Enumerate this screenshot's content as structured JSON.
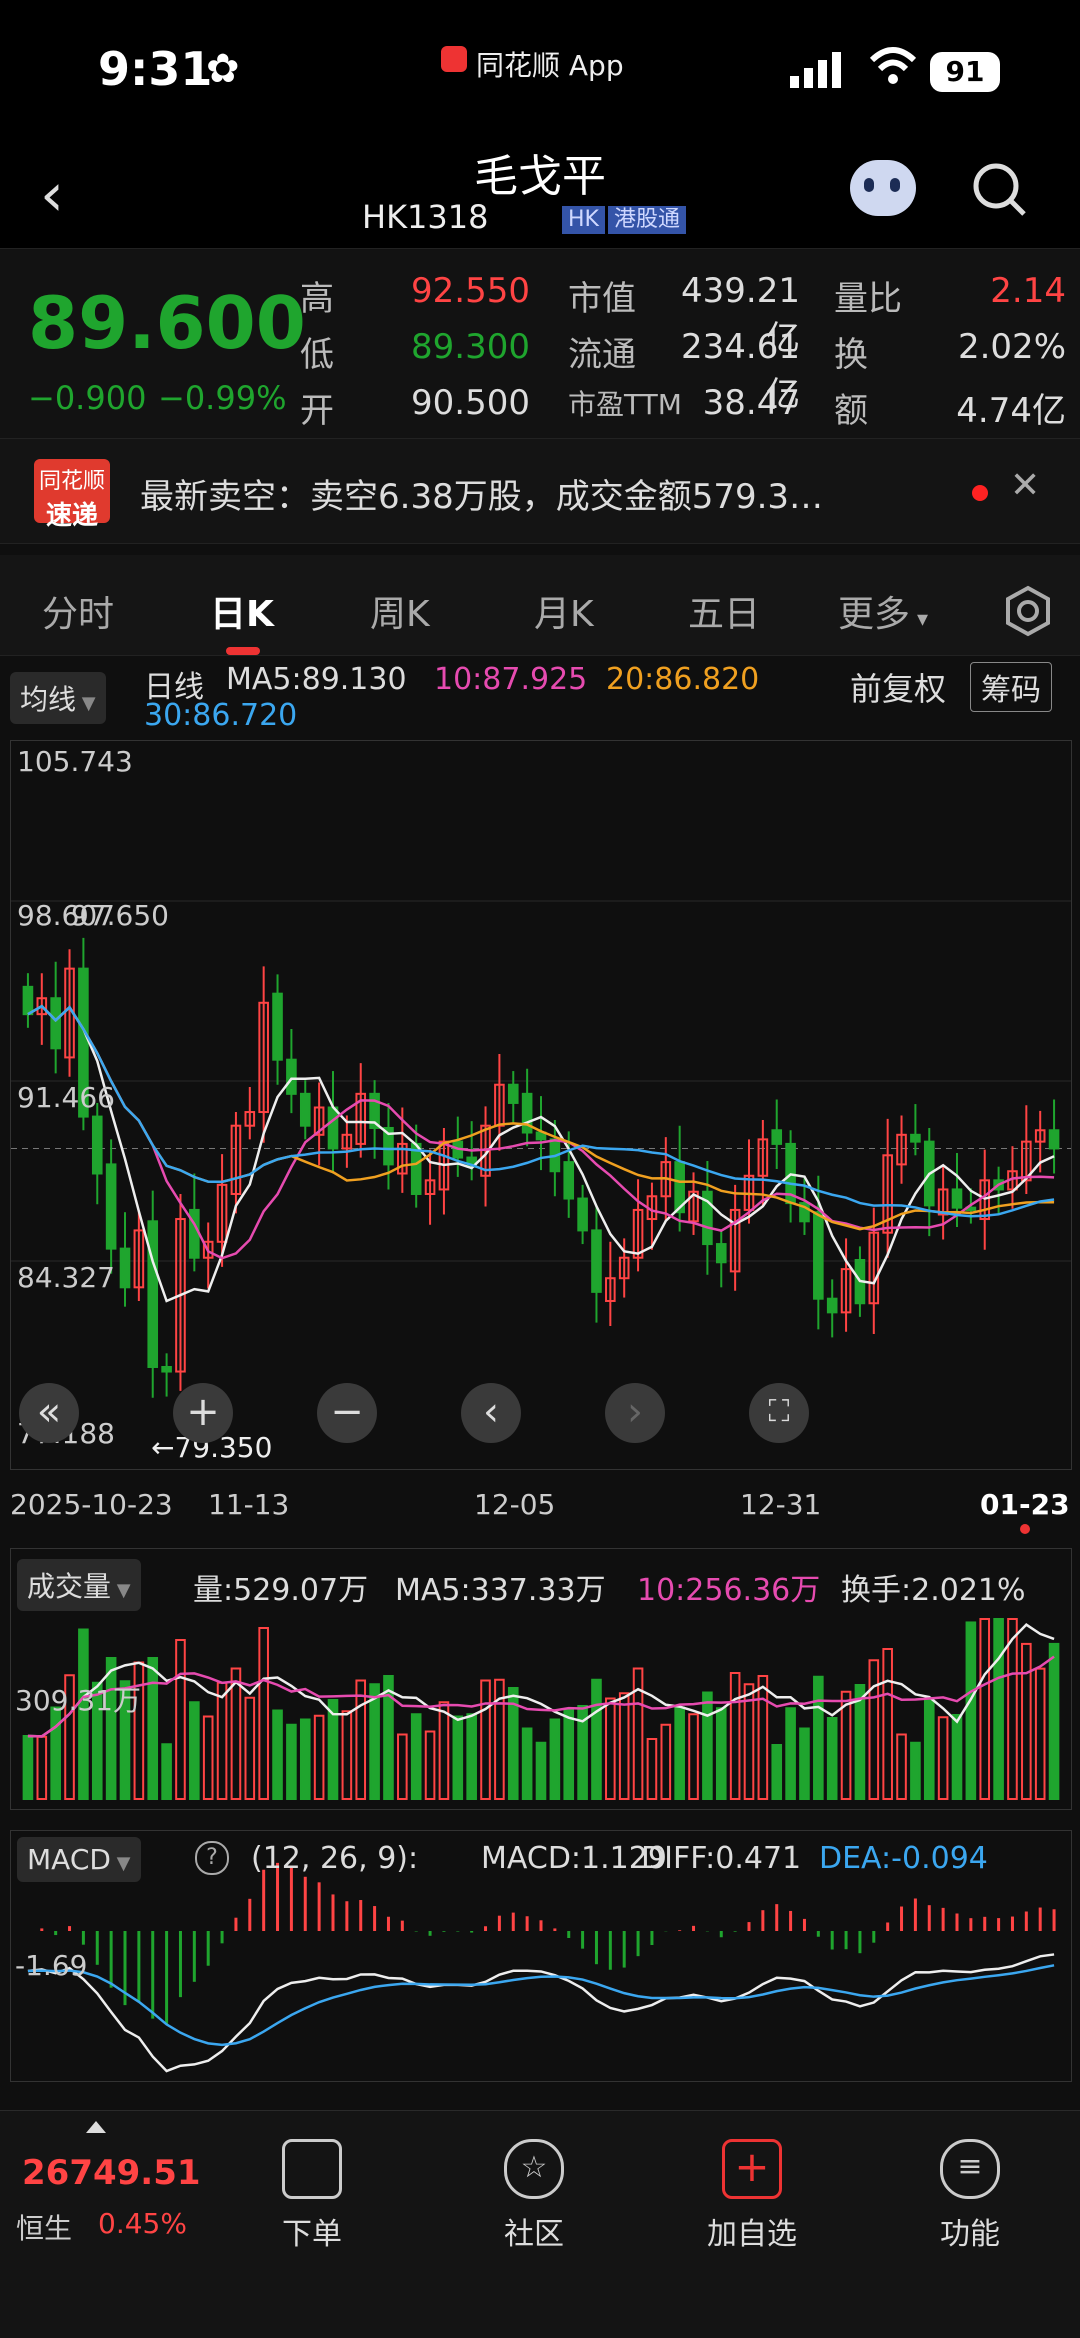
{
  "status": {
    "time": "9:31",
    "app": "同花顺 App",
    "battery": "91"
  },
  "nav": {
    "title": "毛戈平",
    "code": "HK1318",
    "tag1": "HK",
    "tag2": "港股通"
  },
  "quote": {
    "price": "89.600",
    "change": "−0.900",
    "change_pct": "−0.99%",
    "high_label": "高",
    "high": "92.550",
    "low_label": "低",
    "low": "89.300",
    "open_label": "开",
    "open": "90.500",
    "mcap_label": "市值",
    "mcap": "439.21亿",
    "float_label": "流通",
    "float": "234.61亿",
    "pe_label": "市盈TTM",
    "pe": "38.47",
    "volratio_label": "量比",
    "volratio": "2.14",
    "turnover_label": "换",
    "turnover": "2.02%",
    "amount_label": "额",
    "amount": "4.74亿",
    "colors": {
      "up": "#ff4444",
      "down": "#1fa52e"
    }
  },
  "news": {
    "logo1": "同花顺",
    "logo2": "速递",
    "text": "最新卖空：卖空6.38万股，成交金额579.3…"
  },
  "tabs": [
    "分时",
    "日K",
    "周K",
    "月K",
    "五日",
    "更多"
  ],
  "ma": {
    "selector": "均线",
    "kind": "日线",
    "ma5": "MA5:89.130",
    "ma10": "10:87.925",
    "ma20": "20:86.820",
    "ma30": "30:86.720",
    "adjust": "前复权",
    "chips": "筹码"
  },
  "price_labels": {
    "top": "105.743",
    "mid1": "98.607",
    "mid1b": "97.650",
    "mid2": "91.466",
    "mid3": "84.327",
    "bottom": "77.188",
    "low_mark": "←79.350"
  },
  "dates": [
    "2025-10-23",
    "11-13",
    "12-05",
    "12-31",
    "01-23"
  ],
  "volume": {
    "selector": "成交量",
    "vol": "量:529.07万",
    "ma5": "MA5:337.33万",
    "ma10": "10:256.36万",
    "turnover": "换手:2.021%",
    "axis": "309.31万"
  },
  "macd": {
    "selector": "MACD",
    "params": "(12, 26, 9):",
    "macd": "MACD:1.129",
    "diff": "DIFF:0.471",
    "dea": "DEA:-0.094",
    "axis": "-1.69"
  },
  "bottom": {
    "index_value": "26749.51",
    "index_name": "恒生",
    "index_change": "0.45%",
    "items": [
      "下单",
      "社区",
      "加自选",
      "功能"
    ]
  },
  "chart_data": {
    "type": "candlestick",
    "title": "",
    "ylim": [
      77.188,
      105.743
    ],
    "x_ticks": [
      "2025-10-23",
      "11-13",
      "12-05",
      "12-31",
      "01-23"
    ],
    "close": [
      95.5,
      96.2,
      94.0,
      97.5,
      91.0,
      88.5,
      85.2,
      83.5,
      86.0,
      80.0,
      79.8,
      86.5,
      84.8,
      85.5,
      88.0,
      90.6,
      91.2,
      96.0,
      93.5,
      92.0,
      90.6,
      91.4,
      89.6,
      90.2,
      92.0,
      90.5,
      88.9,
      89.8,
      87.6,
      88.2,
      89.9,
      89.2,
      88.8,
      90.6,
      92.4,
      91.6,
      90.3,
      90.0,
      88.6,
      87.4,
      86.0,
      83.3,
      83.9,
      84.8,
      86.9,
      87.5,
      89.0,
      86.8,
      87.7,
      85.4,
      84.6,
      86.9,
      88.4,
      90.0,
      89.8,
      87.2,
      86.4,
      83.0,
      82.4,
      84.3,
      82.8,
      85.9,
      89.3,
      90.2,
      89.9,
      87.1,
      87.8,
      87.0,
      86.9,
      88.2,
      87.8,
      88.6,
      89.9,
      90.4,
      89.6
    ],
    "ma5_last": 89.13,
    "ma10_last": 87.925,
    "ma20_last": 86.82,
    "ma30_last": 86.72,
    "volume_unit": "万",
    "volume_last": 529.07,
    "macd_last": 1.129,
    "diff_last": 0.471,
    "dea_last": -0.094
  }
}
